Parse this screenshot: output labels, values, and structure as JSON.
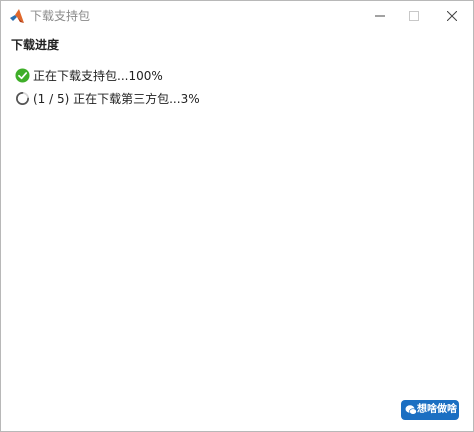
{
  "window": {
    "title": "下载支持包",
    "app_icon": "matlab-logo-icon"
  },
  "window_controls": {
    "minimize_icon": "minimize-icon",
    "maximize_icon": "maximize-icon",
    "close_icon": "close-icon"
  },
  "content": {
    "heading": "下载进度",
    "items": [
      {
        "icon": "check-circle-icon",
        "text": "正在下载支持包...100%",
        "progress_percent": 100
      },
      {
        "icon": "spinner-icon",
        "text": "(1 / 5) 正在下载第三方包...3%",
        "progress_percent": 3
      }
    ]
  },
  "watermark": {
    "icon": "wechat-icon",
    "text": "想啥做啥"
  },
  "colors": {
    "success": "#3fae29",
    "spinner": "#555555",
    "watermark_bg": "#1b6fc2"
  }
}
